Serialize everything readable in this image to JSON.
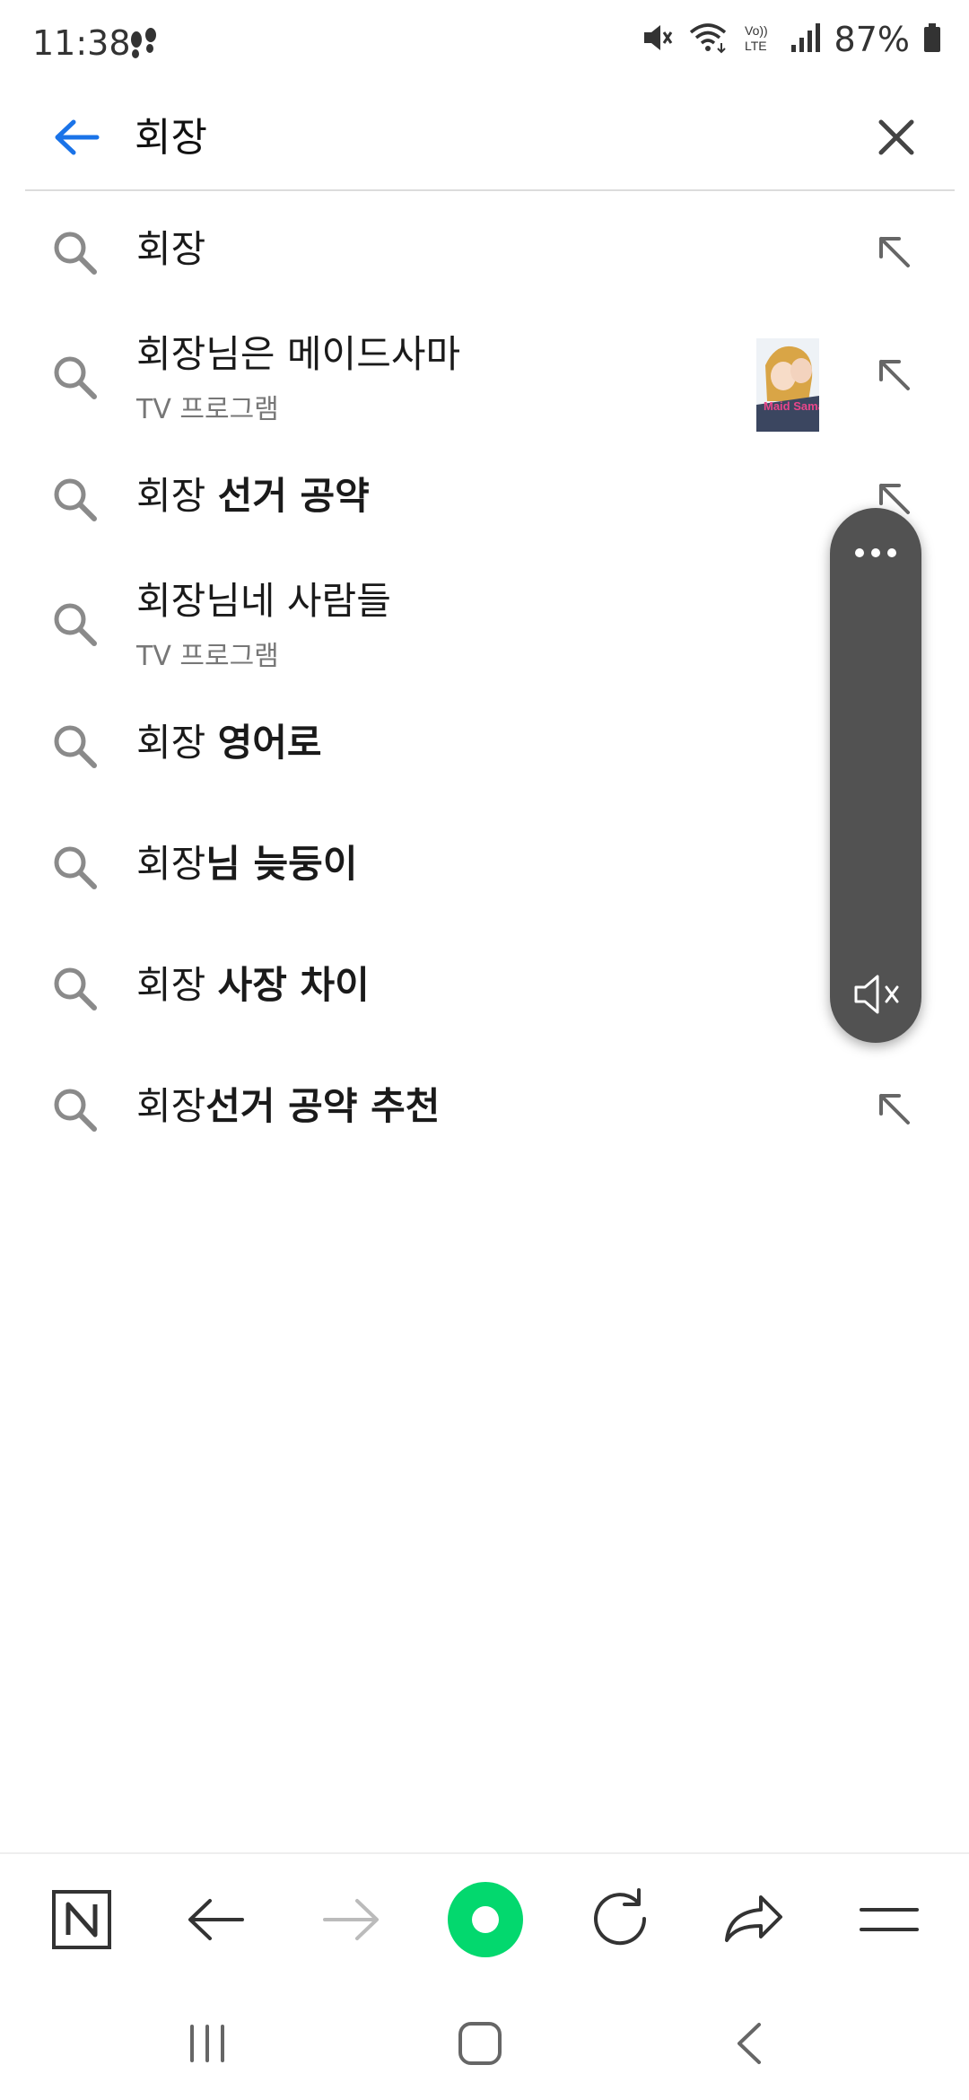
{
  "status_bar": {
    "time": "11:38",
    "battery": "87%",
    "icons": [
      "footsteps-icon",
      "mute-icon",
      "wifi-icon",
      "volte-icon",
      "signal-icon",
      "battery-icon"
    ]
  },
  "search": {
    "query": "회장"
  },
  "suggestions": [
    {
      "prefix": "회장",
      "bold": "",
      "sub": ""
    },
    {
      "prefix": "회장님은 메이드사마",
      "bold": "",
      "sub": "TV 프로그램",
      "thumb_text": "Maid Sama!"
    },
    {
      "prefix": "회장 ",
      "bold": "선거 공약",
      "sub": ""
    },
    {
      "prefix": "회장님네 사람들",
      "bold": "",
      "sub": "TV 프로그램"
    },
    {
      "prefix": "회장 ",
      "bold": "영어로",
      "sub": ""
    },
    {
      "prefix": "회장",
      "bold": "님 늦둥이",
      "sub": ""
    },
    {
      "prefix": "회장 ",
      "bold": "사장 차이",
      "sub": ""
    },
    {
      "prefix": "회장",
      "bold": "선거 공약 추천",
      "sub": ""
    }
  ],
  "toolbar": {
    "items": [
      "naver-home-icon",
      "back-arrow-icon",
      "forward-arrow-icon",
      "green-dot-icon",
      "refresh-icon",
      "share-icon",
      "menu-icon"
    ]
  },
  "colors": {
    "accent_blue": "#1a73e8",
    "green_button": "#03d86e",
    "panel_gray": "#525252"
  }
}
